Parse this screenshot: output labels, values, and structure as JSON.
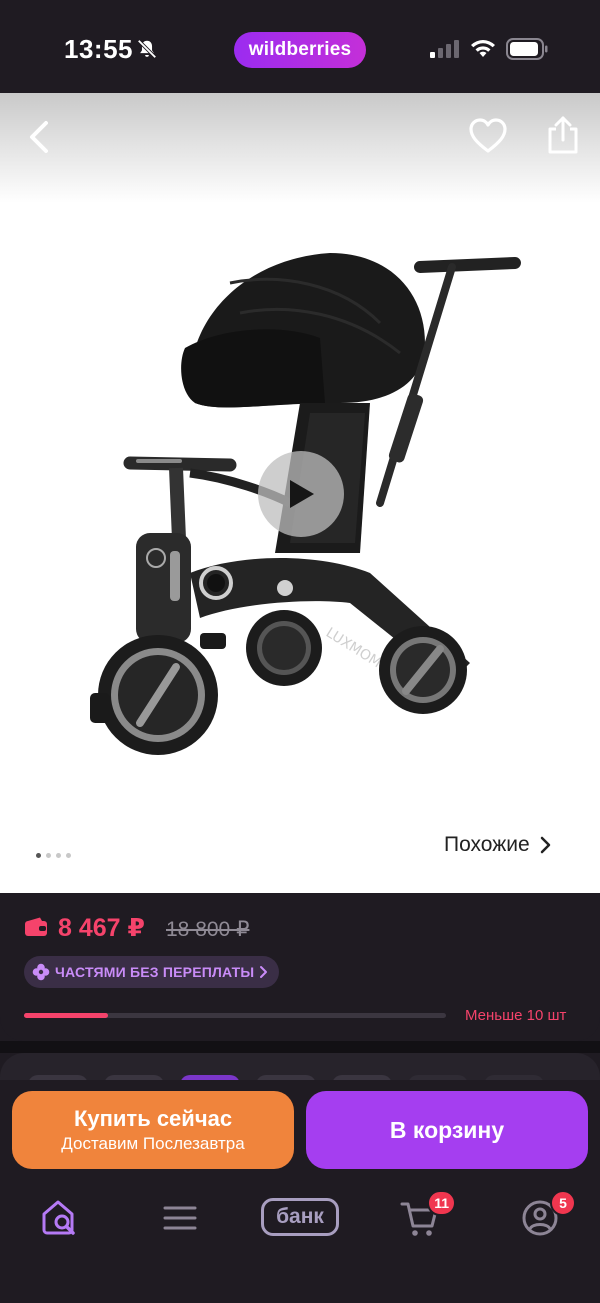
{
  "status_bar": {
    "time": "13:55",
    "brand": "wildberries",
    "icons": [
      "bell-off-icon",
      "signal-icon",
      "wifi-icon",
      "battery-icon"
    ]
  },
  "gallery": {
    "back_icon": "chevron-left-icon",
    "favorite_icon": "heart-icon",
    "share_icon": "share-icon",
    "play_icon": "play-icon",
    "image_brand_text": "LUXMOM",
    "pages_total": 4,
    "page_active": 1,
    "similar_label": "Похожие",
    "similar_icon": "chevron-right-icon"
  },
  "price": {
    "current": "8 467 ₽",
    "old": "18 800 ₽",
    "wallet_icon": "wallet-icon",
    "installment_label": "ЧАСТЯМИ БЕЗ ПЕРЕПЛАТЫ",
    "installment_icon": "installment-icon",
    "stock_label": "Меньше 10 шт",
    "stock_fraction": 0.2
  },
  "actions": {
    "buy_now_label": "Купить сейчас",
    "buy_now_sub": "Доставим Послезавтра",
    "to_cart_label": "В корзину"
  },
  "bottom_nav": {
    "home_icon": "home-search-icon",
    "catalog_icon": "menu-icon",
    "bank_label": "банк",
    "cart_icon": "cart-icon",
    "cart_badge": "11",
    "profile_icon": "profile-icon",
    "profile_badge": "5"
  },
  "colors": {
    "background": "#1f1b22",
    "accent_pink": "#f5436b",
    "buy_now": "#f0843c",
    "to_cart": "#a53ef0",
    "brand_gradient": [
      "#9b2cf0",
      "#c42fd8"
    ]
  }
}
